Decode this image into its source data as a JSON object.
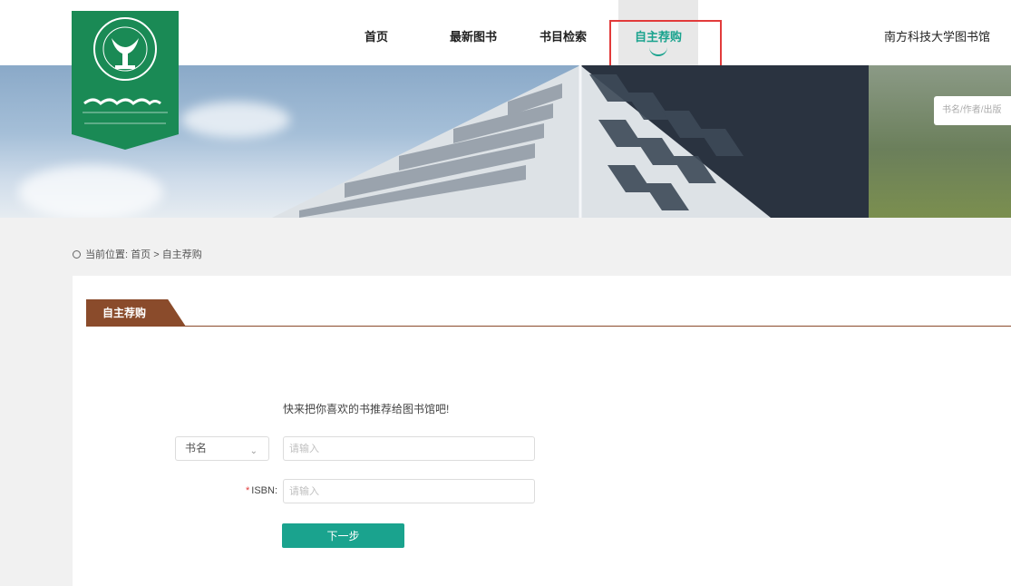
{
  "nav": {
    "items": [
      {
        "label": "首页"
      },
      {
        "label": "最新图书"
      },
      {
        "label": "书目检索"
      },
      {
        "label": "自主荐购"
      }
    ],
    "library_name": "南方科技大学图书馆"
  },
  "banner": {
    "search_placeholder": "书名/作者/出版"
  },
  "breadcrumb": {
    "prefix": "当前位置:",
    "home": "首页",
    "separator": ">",
    "current": "自主荐购"
  },
  "form": {
    "tab_label": "自主荐购",
    "intro": "快来把你喜欢的书推荐给图书馆吧!",
    "select_value": "书名",
    "title_placeholder": "请输入",
    "isbn_label": "ISBN:",
    "isbn_required_mark": "*",
    "isbn_placeholder": "请输入",
    "next_label": "下一步"
  },
  "colors": {
    "accent": "#1aa38e",
    "tab": "#8a4b2b",
    "logo": "#1a8a55",
    "highlight": "#e23b3b"
  },
  "icons": [
    "university-logo",
    "location-icon",
    "chevron-down-icon",
    "smile-underline-icon"
  ]
}
